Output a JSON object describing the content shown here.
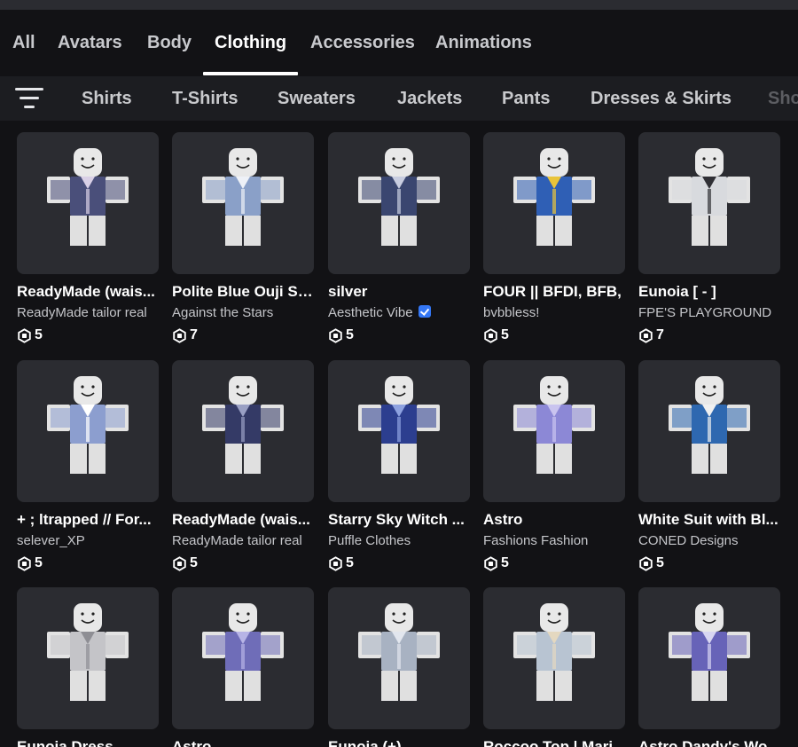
{
  "categories": [
    "All",
    "Avatars",
    "Body",
    "Clothing",
    "Accessories",
    "Animations"
  ],
  "active_category": "Clothing",
  "subcategories": [
    "Shirts",
    "T-Shirts",
    "Sweaters",
    "Jackets",
    "Pants",
    "Dresses & Skirts",
    "Sho"
  ],
  "items": [
    {
      "name": "ReadyMade (wais...",
      "creator": "ReadyMade tailor real",
      "price": "5",
      "outfit": "#4a4f7a",
      "accent": "#d9d0e6"
    },
    {
      "name": "Polite Blue Ouji Sh...",
      "creator": "Against the Stars",
      "price": "7",
      "outfit": "#8aa0c8",
      "accent": "#eef1f7"
    },
    {
      "name": "silver",
      "creator": "Aesthetic Vibe",
      "verified": true,
      "price": "5",
      "outfit": "#3a4670",
      "accent": "#c8cde0"
    },
    {
      "name": "FOUR || BFDI, BFB,",
      "creator": "bvbbless!",
      "price": "5",
      "outfit": "#2f5fb5",
      "accent": "#e9c43a"
    },
    {
      "name": "Eunoia [ - ]",
      "creator": "FPE'S PLAYGROUND",
      "price": "7",
      "outfit": "#d8dade",
      "accent": "#303035"
    },
    {
      "name": "+ ; ltrapped // For...",
      "creator": "selever_XP",
      "price": "5",
      "outfit": "#8c9ecf",
      "accent": "#ffffff"
    },
    {
      "name": "ReadyMade (wais...",
      "creator": "ReadyMade tailor real",
      "price": "5",
      "outfit": "#343a66",
      "accent": "#9aa0c4"
    },
    {
      "name": "Starry Sky Witch ...",
      "creator": "Puffle Clothes",
      "price": "5",
      "outfit": "#2c3e8f",
      "accent": "#8ea2e0"
    },
    {
      "name": "Astro",
      "creator": "Fashions Fashion",
      "price": "5",
      "outfit": "#8c88d6",
      "accent": "#c9c4ef"
    },
    {
      "name": "White Suit with Bl...",
      "creator": "CONED Designs",
      "price": "5",
      "outfit": "#2e68b0",
      "accent": "#f0f0f0"
    },
    {
      "name": "Eunoia Dress",
      "creator": "",
      "price": "",
      "outfit": "#c4c4c8",
      "accent": "#8e8e94"
    },
    {
      "name": "Astro",
      "creator": "",
      "price": "",
      "outfit": "#6f6db8",
      "accent": "#b7b4e6"
    },
    {
      "name": "Eunoia (+)",
      "creator": "",
      "price": "",
      "outfit": "#a8b2c2",
      "accent": "#e2e6ee"
    },
    {
      "name": "Roccoo Top | Mari...",
      "creator": "",
      "price": "",
      "outfit": "#b8c4d2",
      "accent": "#e4d8c0"
    },
    {
      "name": "Astro Dandy's Wo...",
      "creator": "",
      "price": "",
      "outfit": "#6763b8",
      "accent": "#d8d6f2"
    }
  ]
}
